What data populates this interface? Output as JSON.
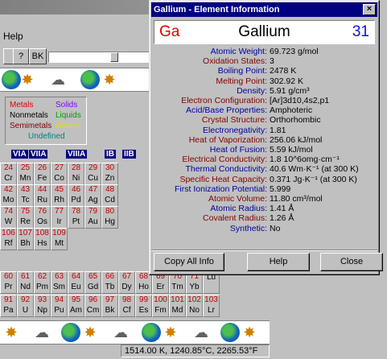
{
  "background": {
    "menu_help": "Help",
    "toolbar": {
      "btn1": "?",
      "btn2": "BK"
    },
    "legend": {
      "metals": "Metals",
      "solids": "Solids",
      "nonmetals": "Nonmetals",
      "liquids": "Liquids",
      "semimetals": "Semimetals",
      "gases": "Gases",
      "undefined": "Undefined"
    },
    "groups": [
      "VIA",
      "VIIA",
      "VIIIA",
      "IB",
      "IIB"
    ],
    "table_rows": [
      [
        {
          "n": "24",
          "s": "Cr"
        },
        {
          "n": "25",
          "s": "Mn"
        },
        {
          "n": "26",
          "s": "Fe"
        },
        {
          "n": "27",
          "s": "Co"
        },
        {
          "n": "28",
          "s": "Ni"
        },
        {
          "n": "29",
          "s": "Cu"
        },
        {
          "n": "30",
          "s": "Zn"
        }
      ],
      [
        {
          "n": "42",
          "s": "Mo"
        },
        {
          "n": "43",
          "s": "Tc"
        },
        {
          "n": "44",
          "s": "Ru"
        },
        {
          "n": "45",
          "s": "Rh"
        },
        {
          "n": "46",
          "s": "Pd"
        },
        {
          "n": "47",
          "s": "Ag"
        },
        {
          "n": "48",
          "s": "Cd"
        }
      ],
      [
        {
          "n": "74",
          "s": "W"
        },
        {
          "n": "75",
          "s": "Re"
        },
        {
          "n": "76",
          "s": "Os"
        },
        {
          "n": "77",
          "s": "Ir"
        },
        {
          "n": "78",
          "s": "Pt"
        },
        {
          "n": "79",
          "s": "Au"
        },
        {
          "n": "80",
          "s": "Hg"
        }
      ],
      [
        {
          "n": "106",
          "s": "Rf"
        },
        {
          "n": "107",
          "s": "Bh"
        },
        {
          "n": "108",
          "s": "Hs"
        },
        {
          "n": "109",
          "s": "Mt"
        }
      ]
    ],
    "lanth_rows": [
      [
        {
          "n": "60",
          "s": "Pr"
        },
        {
          "n": "61",
          "s": "Nd"
        },
        {
          "n": "62",
          "s": "Pm"
        },
        {
          "n": "63",
          "s": "Sm"
        },
        {
          "n": "64",
          "s": "Eu"
        },
        {
          "n": "65",
          "s": "Gd"
        },
        {
          "n": "66",
          "s": "Tb"
        },
        {
          "n": "67",
          "s": "Dy"
        },
        {
          "n": "68",
          "s": "Ho"
        },
        {
          "n": "69",
          "s": "Er"
        },
        {
          "n": "70",
          "s": "Tm"
        },
        {
          "n": "71",
          "s": "Yb"
        },
        {
          "n": "",
          "s": "Lu"
        }
      ],
      [
        {
          "n": "91",
          "s": "Pa"
        },
        {
          "n": "92",
          "s": "U"
        },
        {
          "n": "93",
          "s": "Np"
        },
        {
          "n": "94",
          "s": "Pu"
        },
        {
          "n": "95",
          "s": "Am"
        },
        {
          "n": "96",
          "s": "Cm"
        },
        {
          "n": "97",
          "s": "Bk"
        },
        {
          "n": "98",
          "s": "Cf"
        },
        {
          "n": "99",
          "s": "Es"
        },
        {
          "n": "100",
          "s": "Fm"
        },
        {
          "n": "101",
          "s": "Md"
        },
        {
          "n": "102",
          "s": "No"
        },
        {
          "n": "103",
          "s": "Lr"
        }
      ]
    ],
    "status": "1514.00 K, 1240.85°C, 2265.53°F"
  },
  "dialog": {
    "title": "Gallium - Element Information",
    "close_glyph": "×",
    "symbol": "Ga",
    "name": "Gallium",
    "number": "31",
    "properties": [
      {
        "label": "Atomic Weight:",
        "value": "69.723 g/mol",
        "color": "blue"
      },
      {
        "label": "Oxidation States:",
        "value": "3",
        "color": "red"
      },
      {
        "label": "Boiling Point:",
        "value": "2478 K",
        "color": "blue"
      },
      {
        "label": "Melting Point:",
        "value": "302.92 K",
        "color": "red"
      },
      {
        "label": "Density:",
        "value": "5.91 g/cm³",
        "color": "blue"
      },
      {
        "label": "Electron Configuration:",
        "value": "[Ar]3d10,4s2,p1",
        "color": "red"
      },
      {
        "label": "Acid/Base Properties:",
        "value": "Amphoteric",
        "color": "blue"
      },
      {
        "label": "Crystal Structure:",
        "value": "Orthorhombic",
        "color": "red"
      },
      {
        "label": "Electronegativity:",
        "value": "1.81",
        "color": "blue"
      },
      {
        "label": "Heat of Vaporization:",
        "value": "256.06 kJ/mol",
        "color": "red"
      },
      {
        "label": "Heat of Fusion:",
        "value": "5.59 kJ/mol",
        "color": "blue"
      },
      {
        "label": "Electrical Conductivity:",
        "value": "1.8 10^6omg·cm⁻¹",
        "color": "red"
      },
      {
        "label": "Thermal Conductivity:",
        "value": "40.6 Wm·K⁻¹ (at 300 K)",
        "color": "blue"
      },
      {
        "label": "Specific Heat Capacity:",
        "value": "0.371 Jg·K⁻¹ (at 300 K)",
        "color": "red"
      },
      {
        "label": "First Ionization Potential:",
        "value": "5.999",
        "color": "blue"
      },
      {
        "label": "Atomic Volume:",
        "value": "11.80 cm³/mol",
        "color": "red"
      },
      {
        "label": "Atomic Radius:",
        "value": "1.41 Å",
        "color": "blue"
      },
      {
        "label": "Covalent Radius:",
        "value": "1.26 Å",
        "color": "red"
      },
      {
        "label": "Synthetic:",
        "value": "No",
        "color": "blue"
      }
    ],
    "buttons": {
      "copy": "Copy All Info",
      "help": "Help",
      "close": "Close"
    }
  }
}
